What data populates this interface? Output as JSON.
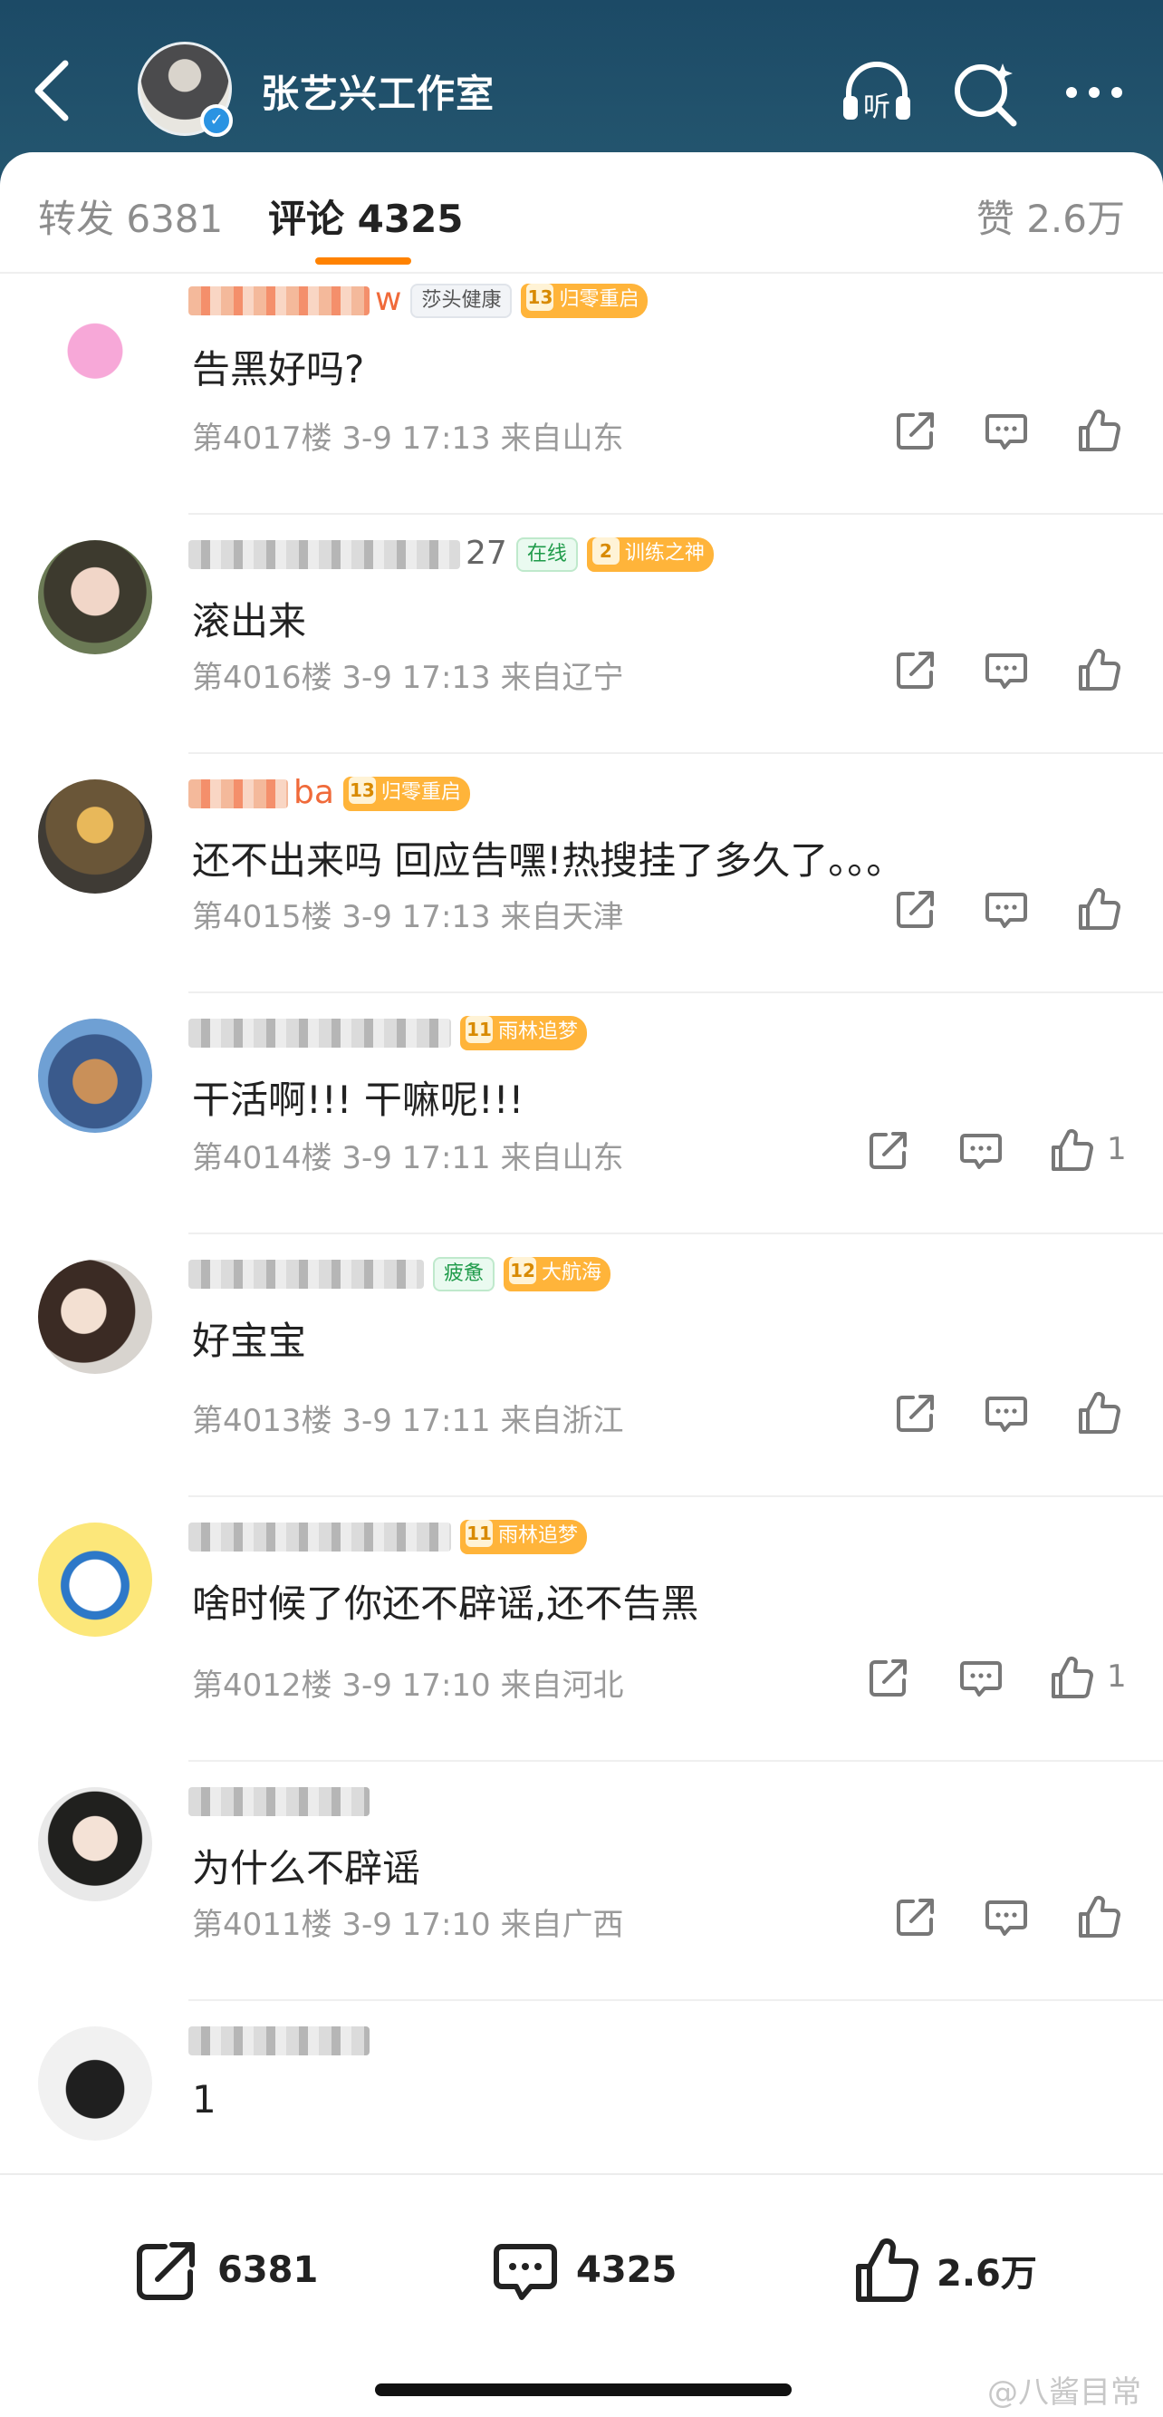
{
  "header": {
    "title": "张艺兴工作室",
    "listen_icon": "listen-headphones-icon",
    "listen_label": "听",
    "search_icon": "search-sparkle-icon",
    "more_icon": "more-dots-icon"
  },
  "tabs": {
    "repost": "转发 6381",
    "comment": "评论 4325",
    "like": "赞 2.6万"
  },
  "comments": [
    {
      "name_visible": "w",
      "badges": [
        {
          "type": "grey",
          "text": "莎头健康"
        },
        {
          "type": "lv",
          "level": "13",
          "text": "归零重启"
        }
      ],
      "text": "告黑好吗?",
      "meta": "第4017楼 3-9 17:13 来自山东",
      "likes": ""
    },
    {
      "name_visible": "27",
      "badges": [
        {
          "type": "green",
          "text": "在线"
        },
        {
          "type": "lv",
          "level": "2",
          "text": "训练之神"
        }
      ],
      "text": "滚出来",
      "meta": "第4016楼 3-9 17:13 来自辽宁",
      "likes": ""
    },
    {
      "name_visible": "ba",
      "badges": [
        {
          "type": "lv",
          "level": "13",
          "text": "归零重启"
        }
      ],
      "text": "还不出来吗 回应告嘿!热搜挂了多久了。。。",
      "meta": "第4015楼 3-9 17:13 来自天津",
      "likes": ""
    },
    {
      "name_visible": "",
      "badges": [
        {
          "type": "lv",
          "level": "11",
          "text": "雨林追梦"
        }
      ],
      "text": "干活啊!!! 干嘛呢!!!",
      "meta": "第4014楼 3-9 17:11 来自山东",
      "likes": "1"
    },
    {
      "name_visible": "",
      "badges": [
        {
          "type": "green",
          "text": "疲惫"
        },
        {
          "type": "lv",
          "level": "12",
          "text": "大航海"
        }
      ],
      "text": "好宝宝",
      "meta": "第4013楼 3-9 17:11 来自浙江",
      "likes": ""
    },
    {
      "name_visible": "",
      "badges": [
        {
          "type": "lv",
          "level": "11",
          "text": "雨林追梦"
        }
      ],
      "text": "啥时候了你还不辟谣,还不告黑",
      "meta": "第4012楼 3-9 17:10 来自河北",
      "likes": "1"
    },
    {
      "name_visible": "",
      "badges": [],
      "text": "为什么不辟谣",
      "meta": "第4011楼 3-9 17:10 来自广西",
      "likes": ""
    },
    {
      "name_visible": "",
      "badges": [],
      "text": "1",
      "meta": "",
      "likes": ""
    }
  ],
  "bottom": {
    "repost_count": "6381",
    "comment_count": "4325",
    "like_count": "2.6万"
  },
  "watermark": "@八酱目常",
  "colors": {
    "accent": "#ff8200",
    "header": "#1f4f6b",
    "level_badge": "#ffb43a"
  }
}
